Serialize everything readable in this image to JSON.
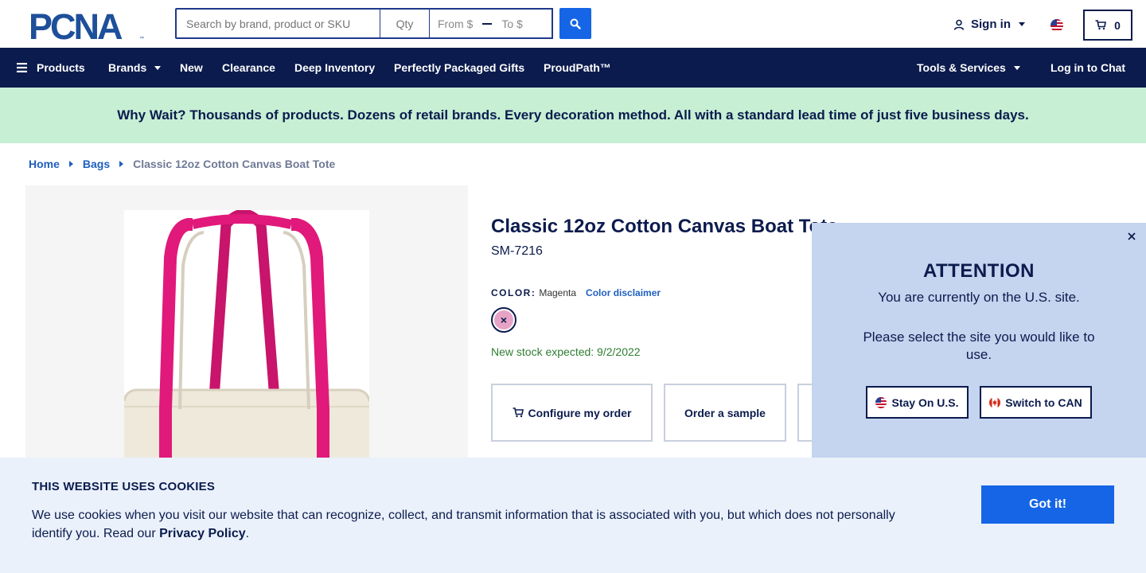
{
  "header": {
    "logo_text": "PCNA",
    "search_placeholder": "Search by brand, product or SKU",
    "qty_placeholder": "Qty",
    "price_from": "From $",
    "price_to": "To $",
    "signin_label": "Sign in",
    "cart_count": "0"
  },
  "nav": {
    "items": [
      {
        "label": "Products"
      },
      {
        "label": "Brands"
      },
      {
        "label": "New"
      },
      {
        "label": "Clearance"
      },
      {
        "label": "Deep Inventory"
      },
      {
        "label": "Perfectly Packaged Gifts"
      },
      {
        "label": "ProudPath™"
      }
    ],
    "tools_label": "Tools & Services",
    "chat_label": "Log in to Chat"
  },
  "promo": {
    "text": "Why Wait? Thousands of products. Dozens of retail brands. Every decoration method. All with a standard lead time of just five business days."
  },
  "breadcrumb": {
    "items": [
      "Home",
      "Bags"
    ],
    "current": "Classic 12oz Cotton Canvas Boat Tote"
  },
  "product": {
    "title": "Classic 12oz Cotton Canvas Boat Tote",
    "sku": "SM-7216",
    "color_label": "COLOR:",
    "color_value": "Magenta",
    "color_disclaimer": "Color disclaimer",
    "stock_text": "New stock expected: 9/2/2022",
    "actions": {
      "configure": "Configure my order",
      "sample": "Order a sample"
    },
    "colors": {
      "tote_canvas": "#efe9dc",
      "tote_strap": "#e0197a",
      "swatch": "#e7a3c6"
    }
  },
  "site_popup": {
    "title": "ATTENTION",
    "line1": "You are currently on the U.S. site.",
    "line2": "Please select the site you would like to use.",
    "stay_label": "Stay On U.S.",
    "switch_label": "Switch to CAN"
  },
  "cookie": {
    "title": "THIS WEBSITE USES COOKIES",
    "text": "We use cookies when you visit our website that can recognize, collect, and transmit information that is associated with you, but which does not personally identify you. Read our ",
    "link": "Privacy Policy",
    "end": ".",
    "button": "Got it!"
  },
  "colors": {
    "navy": "#0b1b4d",
    "accent_blue": "#1565e6",
    "promo_green": "#c6efd4"
  }
}
